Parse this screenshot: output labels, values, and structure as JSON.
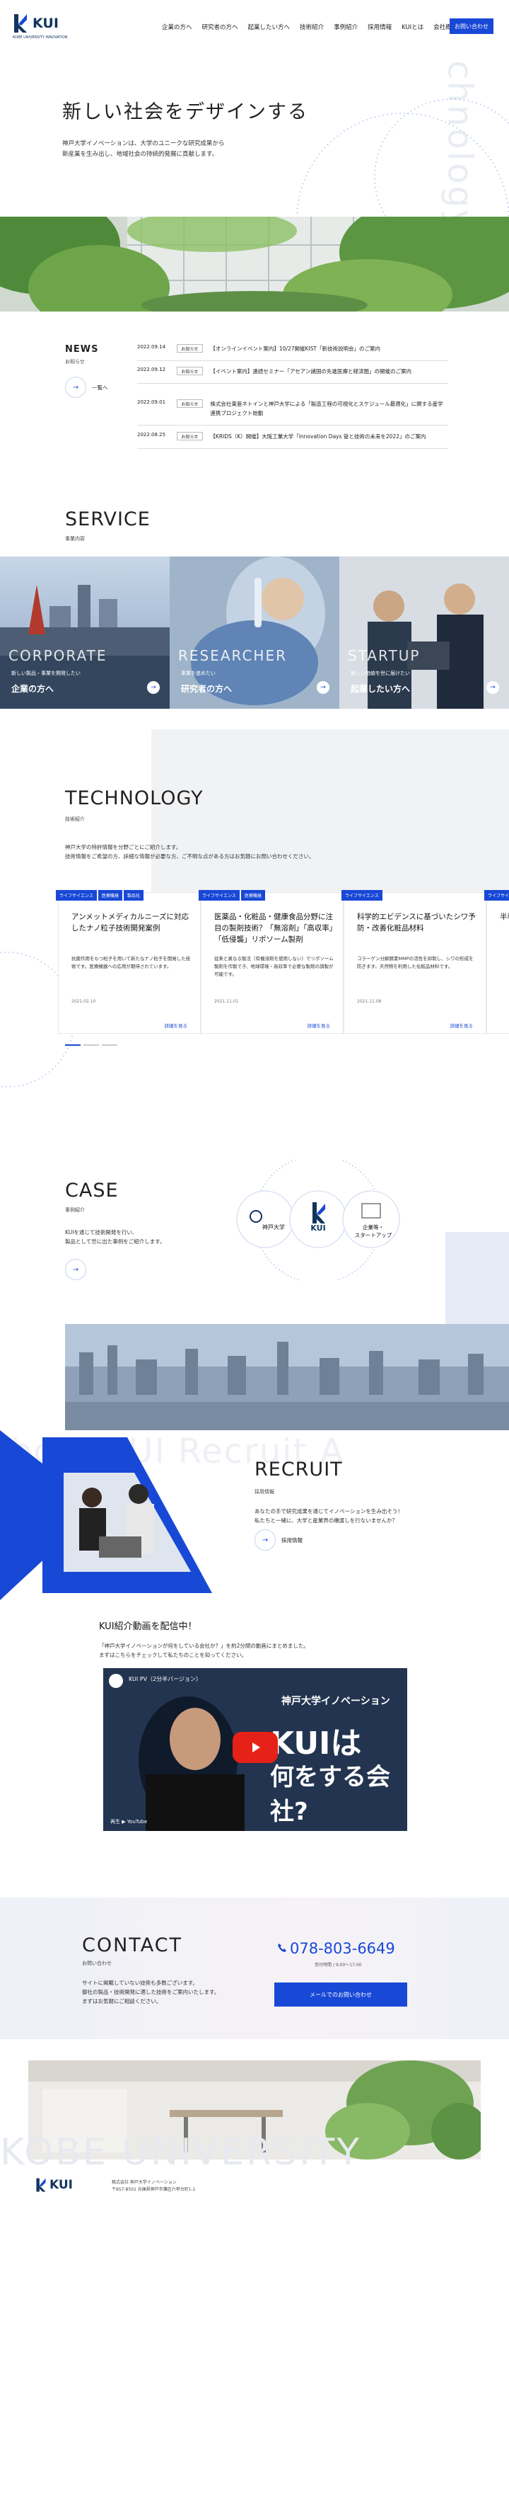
{
  "header": {
    "logo_text": "KUI",
    "logo_sub": "KOBE UNIVERSITY INNOVATION",
    "nav": [
      "企業の方へ",
      "研究者の方へ",
      "起業したい方へ",
      "技術紹介",
      "事例紹介",
      "採用情報",
      "KUIとは",
      "会社概要"
    ],
    "contact_label": "お問い合わせ"
  },
  "hero": {
    "watermark": "Technology",
    "title": "新しい社会をデザインする",
    "description": "神戸大学イノベーションは、大学のユニークな研究成果から\n新産業を生み出し、地域社会の持続的発展に貢献します。"
  },
  "news": {
    "title": "NEWS",
    "subtitle": "お知らせ",
    "more_label": "一覧へ",
    "items": [
      {
        "date": "2022.09.14",
        "tag": "お知らせ",
        "text": "【オンラインイベント案内】10/27開催KIST「新技術説明会」のご案内"
      },
      {
        "date": "2022.09.12",
        "tag": "お知らせ",
        "text": "【イベント案内】連続セミナー「アセアン諸国の先進医療と経済圏」の開催のご案内"
      },
      {
        "date": "2022.09.01",
        "tag": "お知らせ",
        "text": "株式会社東亜ネトインと神戸大学による「製造工程の可視化とスケジュール最適化」に関する産学連携プロジェクト始動"
      },
      {
        "date": "2022.08.25",
        "tag": "お知らせ",
        "text": "【KRIDS（K）開催】大阪工業大学「Innovation Days 管と技術の未来を2022」のご案内"
      }
    ]
  },
  "service": {
    "title": "SERVICE",
    "subtitle": "事業内容",
    "cards": [
      {
        "en": "CORPORATE",
        "desc": "新しい製品・事業を開発したい",
        "label": "企業の方へ"
      },
      {
        "en": "RESEARCHER",
        "desc": "事業を進めたい",
        "label": "研究者の方へ"
      },
      {
        "en": "STARTUP",
        "desc": "新しい価値を世に届けたい",
        "label": "起業したい方へ"
      }
    ]
  },
  "technology": {
    "title": "TECHNOLOGY",
    "subtitle": "技術紹介",
    "description": "神戸大学の特許情報を分野ごとにご紹介します。\n技術情報をご希望の方、詳細な情報が必要な方、ご不明な点がある方はお気軽にお問い合わせください。",
    "cards": [
      {
        "tags": [
          "ライフサイエンス",
          "医療機器",
          "製品化"
        ],
        "title": "アンメットメディカルニーズに対応したナノ粒子技術開発案例",
        "body": "抗菌作用をもつ粒子を用いて新たなナノ粒子を開発した技術です。医療機器への応用が期待されています。",
        "date": "2021.02.10",
        "more": "詳細を見る"
      },
      {
        "tags": [
          "ライフサイエンス",
          "医療機器"
        ],
        "title": "医薬品・化粧品・健康食品分野に注目の製剤技術？「無溶剤」「高収率」「低侵襲」リポソーム製剤",
        "body": "従来と異なる製法（有機溶剤を使用しない）でリポソーム製剤を作製でき、地球環境・高収率で必要な製剤の調製が可能です。",
        "date": "2021.11.01",
        "more": "詳細を見る"
      },
      {
        "tags": [
          "ライフサイエンス"
        ],
        "title": "科学的エビデンスに基づいたシワ予防・改善化粧品材料",
        "body": "コラーゲン分解酵素MMPの活性を抑制し、シワの形成を防ぎます。天然物を利用した化粧品材料です。",
        "date": "2021.11.08",
        "more": "詳細を見る"
      },
      {
        "tags": [
          "ライフサイエンス"
        ],
        "title": "半導体プロセス技術",
        "body": "",
        "date": "",
        "more": ""
      }
    ]
  },
  "case": {
    "title": "CASE",
    "subtitle": "事例紹介",
    "description": "KUIを通じて技術開発を行い、\n製品として世に出た事例をご紹介します。",
    "nodes": [
      "神戸大学",
      "KUI",
      "企業等・\nスタートアップ"
    ]
  },
  "recruit": {
    "watermark": "About KUI Recruit A",
    "title": "RECRUIT",
    "subtitle": "採用情報",
    "description": "あなたの手で研究成果を通じてイノベーションを生み出そう！\n私たちと一緒に、大学と産業界の橋渡しを行ないませんか？",
    "more_label": "採用情報"
  },
  "video": {
    "title": "KUI紹介動画を配信中！",
    "description": "「神戸大学イノベーションが何をしている会社か？」を約2分間の動画にまとめました。\nまずはこちらをチェックして私たちのことを知ってください。",
    "channel_title": "KUI PV（2分半バージョン）",
    "headline1": "神戸大学イノベーション",
    "headline2": "KUIは",
    "headline3": "何をする会社?",
    "watch_label": "再生 ▶ YouTube"
  },
  "contact": {
    "title": "CONTACT",
    "subtitle": "お問い合わせ",
    "description": "サイトに掲載していない技術も多数ございます。\n御社の製品・技術開発に適した技術をご案内いたします。\nまずはお気軽にご相談ください。",
    "phone": "078-803-6649",
    "hours": "受付時間 / 9:00～17:00",
    "mail_label": "メールでのお問い合わせ",
    "watermark": "KOBE UNIVERSITY"
  },
  "footer": {
    "logo_text": "KUI",
    "address": "株式会社 神戸大学イノベーション\n〒657-8501 兵庫県神戸市灘区六甲台町1-1"
  },
  "colors": {
    "accent": "#1848d6",
    "navy": "#12345f"
  }
}
